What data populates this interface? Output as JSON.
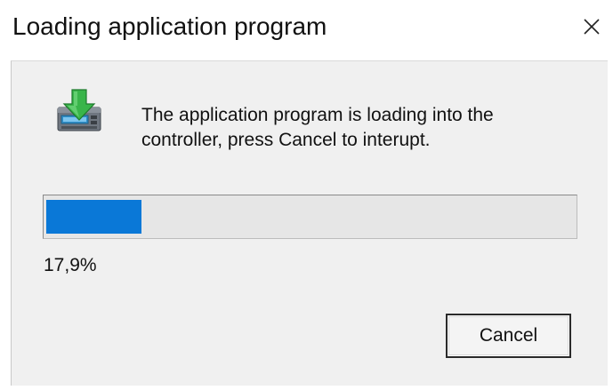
{
  "window": {
    "title": "Loading application program",
    "close_icon": "close-icon"
  },
  "dialog": {
    "icon": "download-to-controller-icon",
    "message": "The application program is loading into the controller, press Cancel to interupt.",
    "progress": {
      "fraction": 0.179,
      "label": "17,9%",
      "color": "#0a78d7"
    },
    "cancel_label": "Cancel"
  }
}
